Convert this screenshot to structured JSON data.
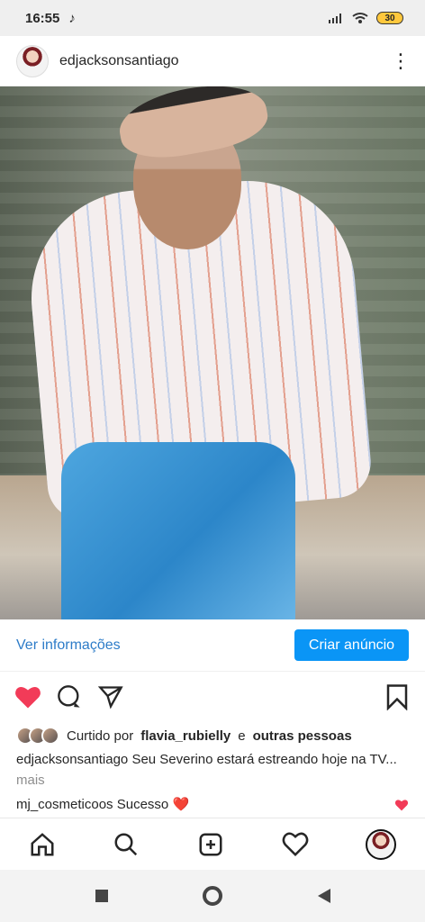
{
  "status": {
    "time": "16:55",
    "battery": "30",
    "icons": [
      "tiktok-icon",
      "signal-icon",
      "wifi-icon",
      "battery-icon"
    ]
  },
  "post": {
    "username": "edjacksonsantiago",
    "cta_link": "Ver informações",
    "cta_button": "Criar anúncio",
    "liked_text": "Curtido por",
    "liked_user": "flavia_rubielly",
    "liked_connector": "e",
    "liked_others": "outras pessoas",
    "caption_user": "edjacksonsantiago",
    "caption_text": "Seu Severino estará estreando hoje na TV...",
    "caption_more": "mais",
    "comment_user": "mj_cosmeticoos",
    "comment_text": "Sucesso",
    "comment_emoji": "❤️"
  },
  "colors": {
    "like": "#f23b58",
    "cta": "#0a95f6",
    "link": "#2d7cc8"
  }
}
